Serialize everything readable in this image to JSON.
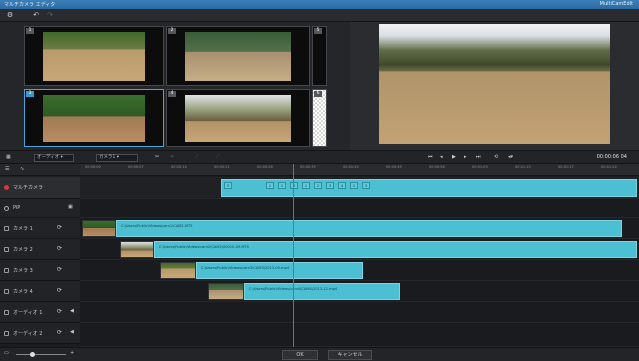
{
  "window": {
    "title": "マルチカメラ エディタ",
    "brand": "MultiCamEdit"
  },
  "toolbar": {
    "settings_icon": "gear-icon",
    "undo_icon": "undo-icon",
    "redo_icon": "redo-icon"
  },
  "cameras": [
    {
      "num": "1"
    },
    {
      "num": "2"
    },
    {
      "num": "3"
    },
    {
      "num": "4"
    },
    {
      "num": "5"
    },
    {
      "num": "6"
    }
  ],
  "controls": {
    "mode_label": "オーディオ",
    "audio_label": "カメラ1",
    "timecode": "00:00:06 04"
  },
  "ruler": {
    "ticks": [
      "00:00:00",
      "00:00:07",
      "00:00:14",
      "00:00:21",
      "00:00:28",
      "00:00:35",
      "00:00:42",
      "00:00:49",
      "00:00:56",
      "00:01:03",
      "00:01:10",
      "00:01:17",
      "00:01:24"
    ]
  },
  "tracks": {
    "multicam": "マルチカメラ",
    "pip": "PiP",
    "cam1": "カメラ 1",
    "cam2": "カメラ 2",
    "cam3": "カメラ 3",
    "cam4": "カメラ 4",
    "audio1": "オーディオ 1",
    "audio2": "オーディオ 2"
  },
  "markers": [
    "3",
    "1",
    "2",
    "3",
    "1",
    "2",
    "3",
    "4",
    "2",
    "3"
  ],
  "clips": {
    "cam1": "C:\\Users\\Public\\Videos\\cam1\\CAM1.MTS",
    "cam2": "C:\\Users\\Public\\Videos\\cam2\\CAM2\\00010-09.MTS",
    "cam3": "C:\\Users\\Public\\Videos\\cam3\\CAM3\\2013-09.mp4",
    "cam4": "C:\\Users\\Public\\Videos\\cam4\\CAM4\\2013-12.mp4"
  },
  "buttons": {
    "ok": "OK",
    "cancel": "キャンセル"
  }
}
